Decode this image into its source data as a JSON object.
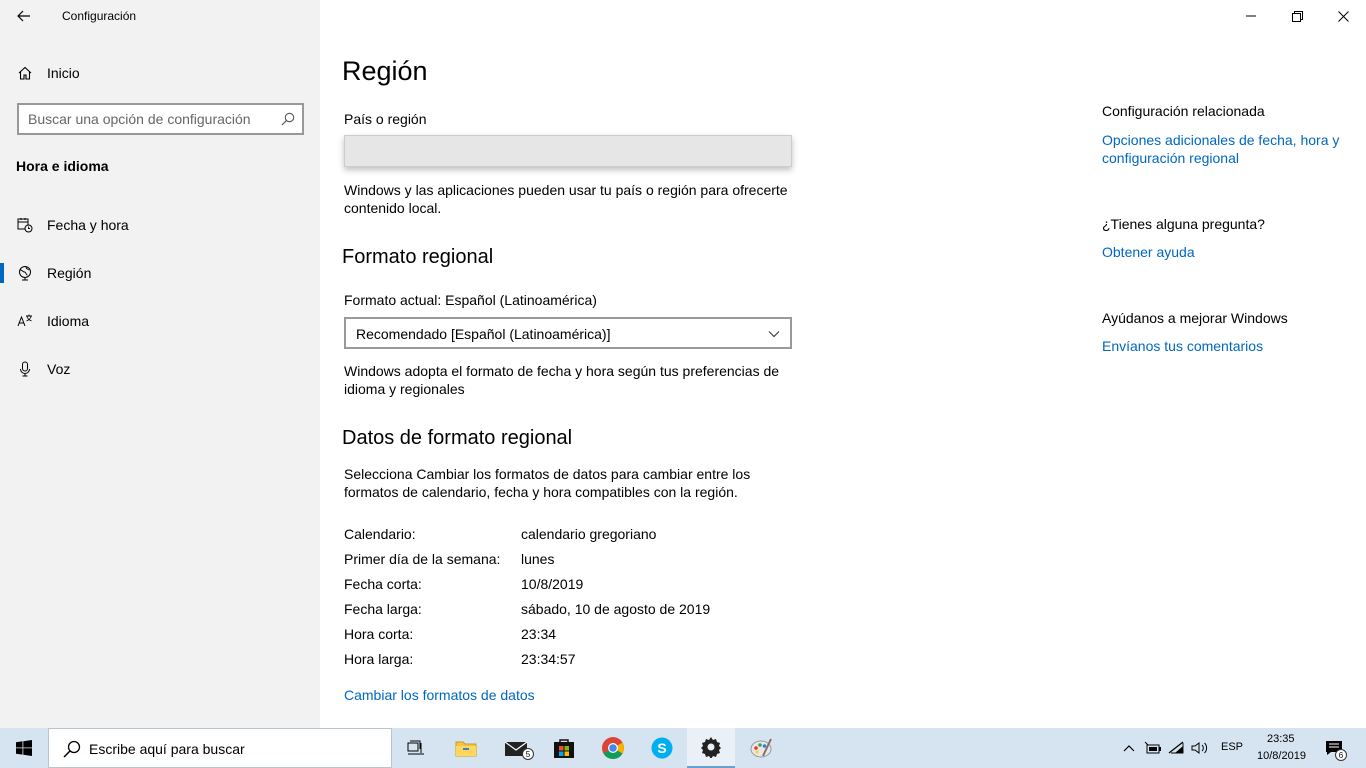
{
  "window": {
    "app_title": "Configuración",
    "controls": [
      "minimize",
      "restore",
      "close"
    ]
  },
  "sidebar": {
    "home_label": "Inicio",
    "search_placeholder": "Buscar una opción de configuración",
    "section_title": "Hora e idioma",
    "items": [
      {
        "label": "Fecha y hora",
        "icon": "calendar-clock-icon",
        "active": false
      },
      {
        "label": "Región",
        "icon": "globe-icon",
        "active": true
      },
      {
        "label": "Idioma",
        "icon": "language-icon",
        "active": false
      },
      {
        "label": "Voz",
        "icon": "microphone-icon",
        "active": false
      }
    ]
  },
  "main": {
    "title": "Región",
    "country_label": "País o región",
    "country_value": "",
    "country_desc": "Windows y las aplicaciones pueden usar tu país o región para ofrecerte contenido local.",
    "regional_format_title": "Formato regional",
    "current_format_label": "Formato actual: Español (Latinoamérica)",
    "format_select_value": "Recomendado [Español (Latinoamérica)]",
    "format_desc": "Windows adopta el formato de fecha y hora según tus preferencias de idioma y regionales",
    "format_data_title": "Datos de formato regional",
    "format_data_desc": "Selecciona Cambiar los formatos de datos para cambiar entre los formatos de calendario, fecha y hora compatibles con la región.",
    "rows": [
      {
        "label": "Calendario:",
        "value": "calendario gregoriano"
      },
      {
        "label": "Primer día de la semana:",
        "value": "lunes"
      },
      {
        "label": "Fecha corta:",
        "value": "10/8/2019"
      },
      {
        "label": "Fecha larga:",
        "value": "sábado, 10 de agosto de 2019"
      },
      {
        "label": "Hora corta:",
        "value": "23:34"
      },
      {
        "label": "Hora larga:",
        "value": "23:34:57"
      }
    ],
    "change_formats_link": "Cambiar los formatos de datos"
  },
  "related": {
    "related_title": "Configuración relacionada",
    "related_link": "Opciones adicionales de fecha, hora y configuración regional",
    "question_title": "¿Tienes alguna pregunta?",
    "help_link": "Obtener ayuda",
    "improve_title": "Ayúdanos a mejorar Windows",
    "feedback_link": "Envíanos tus comentarios"
  },
  "taskbar": {
    "search_text": "Escribe aquí para buscar",
    "apps": [
      "task-view-icon",
      "file-explorer-icon",
      "mail-icon",
      "store-icon",
      "chrome-icon",
      "skype-icon",
      "settings-icon",
      "paint-icon"
    ],
    "mail_badge": "5",
    "language": "ESP",
    "time": "23:35",
    "date": "10/8/2019",
    "notification_badge": "6",
    "accent_color": "#0067c0",
    "taskbar_color": "#d6e4f1"
  }
}
